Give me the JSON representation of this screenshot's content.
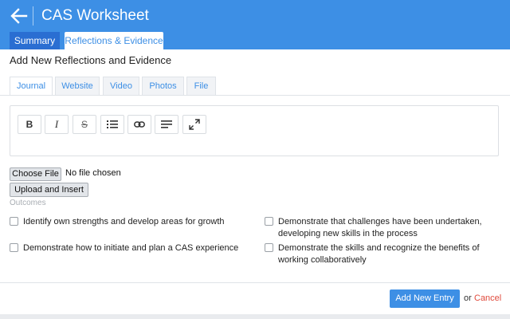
{
  "header": {
    "title": "CAS Worksheet",
    "back_icon": "arrow-left-icon",
    "color": "#3d8fe5"
  },
  "main_tabs": [
    {
      "label": "Summary",
      "active": false
    },
    {
      "label": "Reflections & Evidence",
      "active": true
    }
  ],
  "section": {
    "title": "Add New Reflections and Evidence"
  },
  "sub_tabs": [
    {
      "label": "Journal",
      "active": true
    },
    {
      "label": "Website",
      "active": false
    },
    {
      "label": "Video",
      "active": false
    },
    {
      "label": "Photos",
      "active": false
    },
    {
      "label": "File",
      "active": false
    }
  ],
  "toolbar": {
    "bold": "B",
    "italic": "I",
    "strike": "S",
    "icons": [
      "bold-icon",
      "italic-icon",
      "strikethrough-icon",
      "bulleted-list-icon",
      "link-icon",
      "align-left-icon",
      "fullscreen-icon"
    ]
  },
  "file": {
    "choose_label": "Choose File",
    "status": "No file chosen",
    "upload_label": "Upload and Insert"
  },
  "outcomes": {
    "label": "Outcomes",
    "items": [
      {
        "text": "Identify own strengths and develop areas for growth",
        "checked": false
      },
      {
        "text": "Demonstrate that challenges have been undertaken, developing new skills in the process",
        "checked": false
      },
      {
        "text": "Demonstrate how to initiate and plan a CAS experience",
        "checked": false
      },
      {
        "text": "Demonstrate the skills and recognize the benefits of working collaboratively",
        "checked": false
      }
    ]
  },
  "footer": {
    "add_label": "Add New Entry",
    "or_text": "or",
    "cancel_label": "Cancel",
    "cancel_color": "#e04a3c"
  }
}
